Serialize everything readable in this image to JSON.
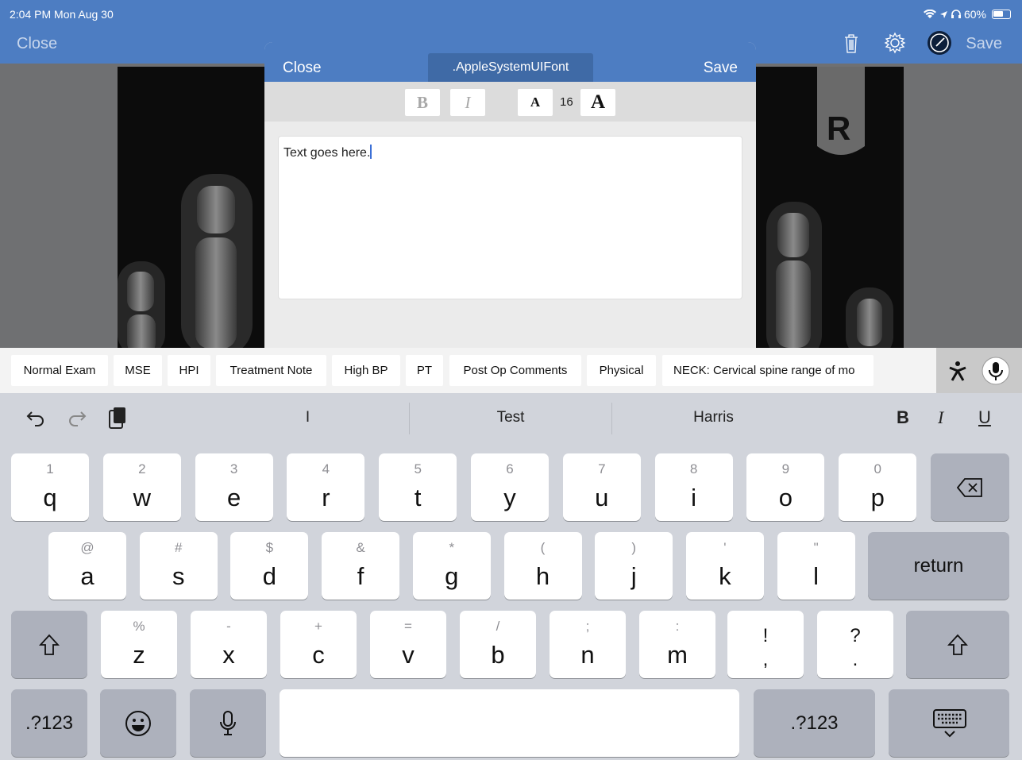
{
  "status_bar": {
    "time": "2:04 PM  Mon Aug 30",
    "battery": "60%"
  },
  "nav": {
    "close": "Close",
    "save": "Save"
  },
  "modal": {
    "close": "Close",
    "save": "Save",
    "font_name": ".AppleSystemUIFont",
    "bold": "B",
    "italic": "I",
    "size_down": "A",
    "size": "16",
    "size_up": "A",
    "text": "Text goes here."
  },
  "shortcuts": [
    "Normal Exam",
    "MSE",
    "HPI",
    "Treatment Note",
    "High BP",
    "PT",
    "Post Op Comments",
    "Physical",
    "NECK: Cervical spine range of mo"
  ],
  "keyboard": {
    "suggestions": [
      "I",
      "Test",
      "Harris"
    ],
    "format": {
      "bold": "B",
      "italic": "I",
      "underline": "U"
    },
    "row1": [
      {
        "sub": "1",
        "key": "q"
      },
      {
        "sub": "2",
        "key": "w"
      },
      {
        "sub": "3",
        "key": "e"
      },
      {
        "sub": "4",
        "key": "r"
      },
      {
        "sub": "5",
        "key": "t"
      },
      {
        "sub": "6",
        "key": "y"
      },
      {
        "sub": "7",
        "key": "u"
      },
      {
        "sub": "8",
        "key": "i"
      },
      {
        "sub": "9",
        "key": "o"
      },
      {
        "sub": "0",
        "key": "p"
      }
    ],
    "row2": [
      {
        "sub": "@",
        "key": "a"
      },
      {
        "sub": "#",
        "key": "s"
      },
      {
        "sub": "$",
        "key": "d"
      },
      {
        "sub": "&",
        "key": "f"
      },
      {
        "sub": "*",
        "key": "g"
      },
      {
        "sub": "(",
        "key": "h"
      },
      {
        "sub": ")",
        "key": "j"
      },
      {
        "sub": "'",
        "key": "k"
      },
      {
        "sub": "\"",
        "key": "l"
      }
    ],
    "row3": [
      {
        "sub": "%",
        "key": "z"
      },
      {
        "sub": "-",
        "key": "x"
      },
      {
        "sub": "+",
        "key": "c"
      },
      {
        "sub": "=",
        "key": "v"
      },
      {
        "sub": "/",
        "key": "b"
      },
      {
        "sub": ";",
        "key": "n"
      },
      {
        "sub": ":",
        "key": "m"
      }
    ],
    "punct1": {
      "top": "!",
      "bottom": ","
    },
    "punct2": {
      "top": "?",
      "bottom": "."
    },
    "return": "return",
    "numbers_left": ".?123",
    "numbers_right": ".?123"
  },
  "icons": [
    "trash-icon",
    "gear-icon",
    "clock-icon",
    "undo-icon",
    "redo-icon",
    "paste-icon",
    "delete-icon",
    "shift-icon",
    "emoji-icon",
    "mic-icon",
    "keyboard-dismiss-icon"
  ]
}
